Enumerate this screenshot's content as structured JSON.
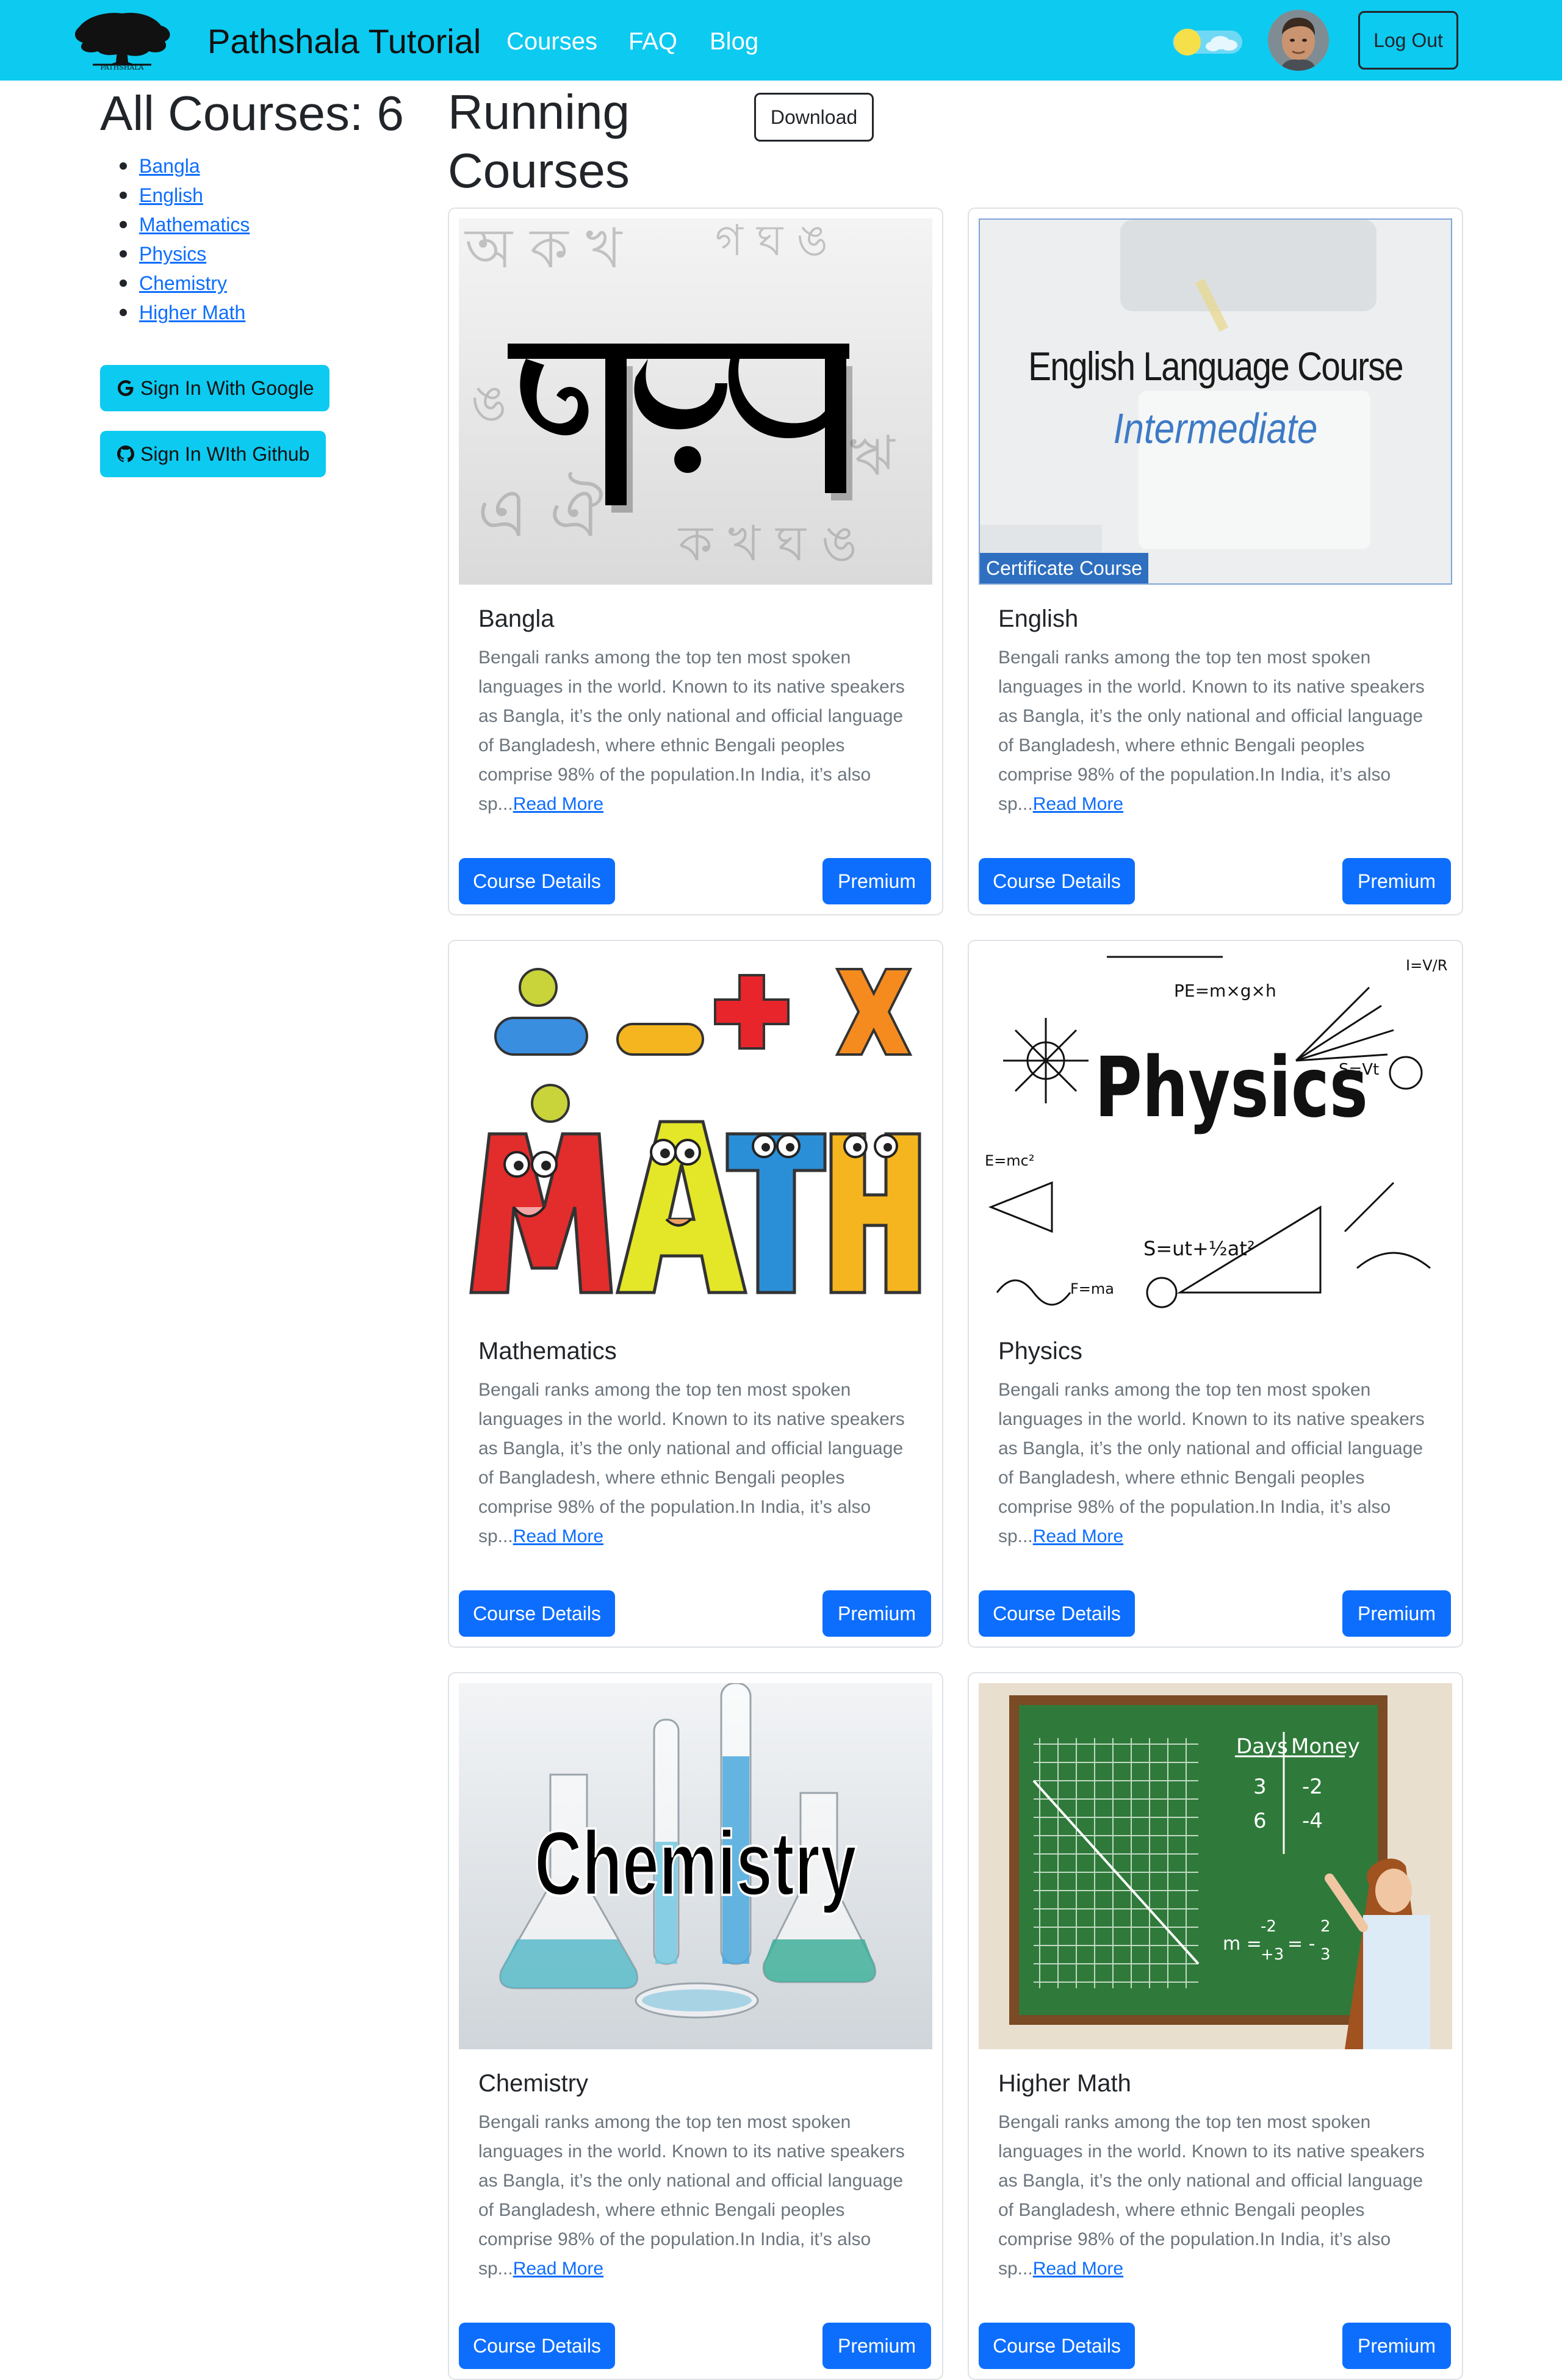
{
  "navbar": {
    "logo_text": "PATHSHALA",
    "brand": "Pathshala Tutorial",
    "links": [
      "Courses",
      "FAQ",
      "Blog"
    ],
    "logout_label": "Log Out"
  },
  "sidebar": {
    "heading": "All Courses: 6",
    "courses": [
      "Bangla",
      "English",
      "Mathematics",
      "Physics",
      "Chemistry",
      "Higher Math"
    ],
    "google_label": "Sign In With Google",
    "github_label": "Sign In WIth Github"
  },
  "main": {
    "title": "Running Courses",
    "download_label": "Download",
    "cards": [
      {
        "title": "Bangla",
        "image_text": "বাংলা",
        "description": "Bengali ranks among the top ten most spoken languages in the world. Known to its native speakers as Bangla, it’s the only national and official language of Bangladesh, where ethnic Bengali peoples comprise 98% of the population.In India, it’s also sp...",
        "read_more": "Read More",
        "details_label": "Course Details",
        "premium_label": "Premium"
      },
      {
        "title": "English",
        "image_text": "English Language Course",
        "image_subtext": "Intermediate",
        "image_badge": "Certificate Course",
        "description": "Bengali ranks among the top ten most spoken languages in the world. Known to its native speakers as Bangla, it’s the only national and official language of Bangladesh, where ethnic Bengali peoples comprise 98% of the population.In India, it’s also sp...",
        "read_more": "Read More",
        "details_label": "Course Details",
        "premium_label": "Premium"
      },
      {
        "title": "Mathematics",
        "image_text": "MATH",
        "description": "Bengali ranks among the top ten most spoken languages in the world. Known to its native speakers as Bangla, it’s the only national and official language of Bangladesh, where ethnic Bengali peoples comprise 98% of the population.In India, it’s also sp...",
        "read_more": "Read More",
        "details_label": "Course Details",
        "premium_label": "Premium"
      },
      {
        "title": "Physics",
        "image_text": "Physics",
        "image_formulas": [
          "PE=m×g×h",
          "S=ut+½at²",
          "I=V/R",
          "E=mc²",
          "F=ma",
          "S=Vt"
        ],
        "description": "Bengali ranks among the top ten most spoken languages in the world. Known to its native speakers as Bangla, it’s the only national and official language of Bangladesh, where ethnic Bengali peoples comprise 98% of the population.In India, it’s also sp...",
        "read_more": "Read More",
        "details_label": "Course Details",
        "premium_label": "Premium"
      },
      {
        "title": "Chemistry",
        "image_text": "Chemistry",
        "description": "Bengali ranks among the top ten most spoken languages in the world. Known to its native speakers as Bangla, it’s the only national and official language of Bangladesh, where ethnic Bengali peoples comprise 98% of the population.In India, it’s also sp...",
        "read_more": "Read More",
        "details_label": "Course Details",
        "premium_label": "Premium"
      },
      {
        "title": "Higher Math",
        "image_board": {
          "col1": "Days",
          "col2": "Money",
          "rows": [
            [
              "3",
              "-2"
            ],
            [
              "6",
              "-4"
            ]
          ],
          "formula_m": "m =",
          "formula_a": "-2",
          "formula_b": "+3",
          "formula_eq": "= -",
          "formula_c": "2",
          "formula_d": "3"
        },
        "description": "Bengali ranks among the top ten most spoken languages in the world. Known to its native speakers as Bangla, it’s the only national and official language of Bangladesh, where ethnic Bengali peoples comprise 98% of the population.In India, it’s also sp...",
        "read_more": "Read More",
        "details_label": "Course Details",
        "premium_label": "Premium"
      }
    ]
  }
}
